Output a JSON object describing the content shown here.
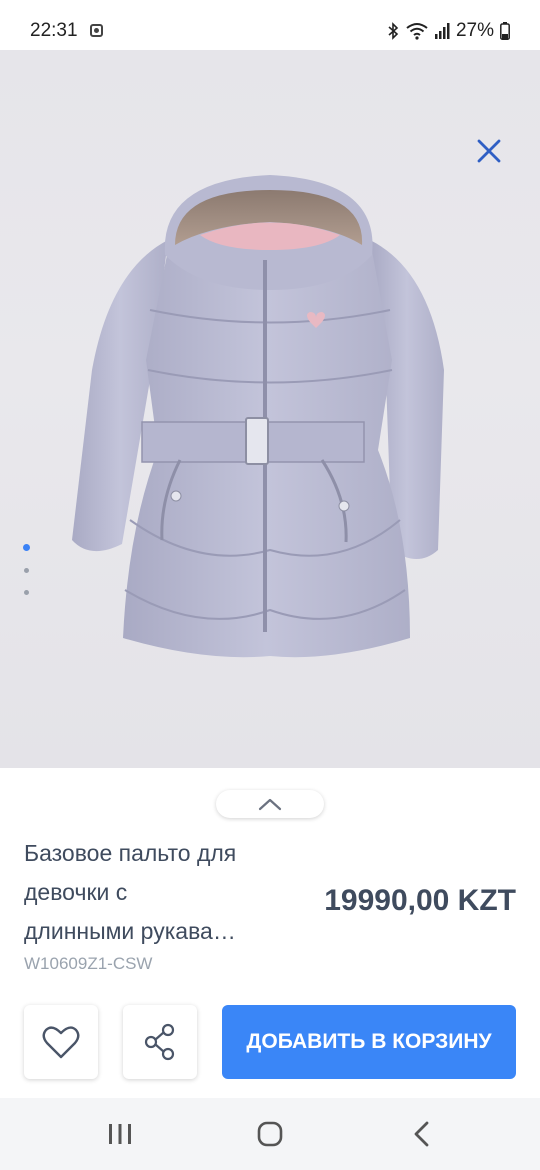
{
  "status_bar": {
    "time": "22:31",
    "battery": "27%"
  },
  "product": {
    "title": "Базовое пальто для\nдевочки с\nдлинными рукава…",
    "sku": "W10609Z1-CSW",
    "price": "19990,00 KZT",
    "image_icon": "jacket-photo",
    "carousel_dots": 3,
    "active_dot": 0
  },
  "actions": {
    "add_to_cart_label": "ДОБАВИТЬ В КОРЗИНУ",
    "favorite_icon": "heart-icon",
    "share_icon": "share-icon"
  },
  "colors": {
    "accent": "#3a86f7",
    "text": "#3f4b5e",
    "muted": "#9aa3ae"
  }
}
